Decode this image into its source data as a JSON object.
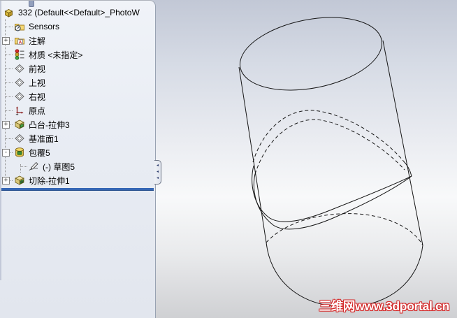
{
  "window": {
    "app": "SolidWorks part document"
  },
  "feature_tree": {
    "root": {
      "label": "332  (Default<<Default>_PhotoW"
    },
    "items": [
      {
        "label": "Sensors"
      },
      {
        "label": "注解"
      },
      {
        "label": "材质 <未指定>"
      },
      {
        "label": "前视"
      },
      {
        "label": "上视"
      },
      {
        "label": "右视"
      },
      {
        "label": "原点"
      },
      {
        "label": "凸台-拉伸3"
      },
      {
        "label": "基准面1"
      },
      {
        "label": "包覆5"
      },
      {
        "label": "(-) 草图5"
      },
      {
        "label": "切除-拉伸1"
      }
    ]
  },
  "ui": {
    "expand_collapsed": "+",
    "expand_expanded": "-",
    "splitter_arrow": "◂"
  },
  "viewport": {
    "watermark": "三维网www.3dportal.cn"
  },
  "colors": {
    "rollback_bar": "#3566b4",
    "panel_background": "#e9edf4",
    "viewport_gradient_top": "#c2c8d6",
    "viewport_gradient_bottom": "#cfd0d3",
    "watermark_red": "#d42a2a",
    "edge_stroke": "#161616"
  }
}
